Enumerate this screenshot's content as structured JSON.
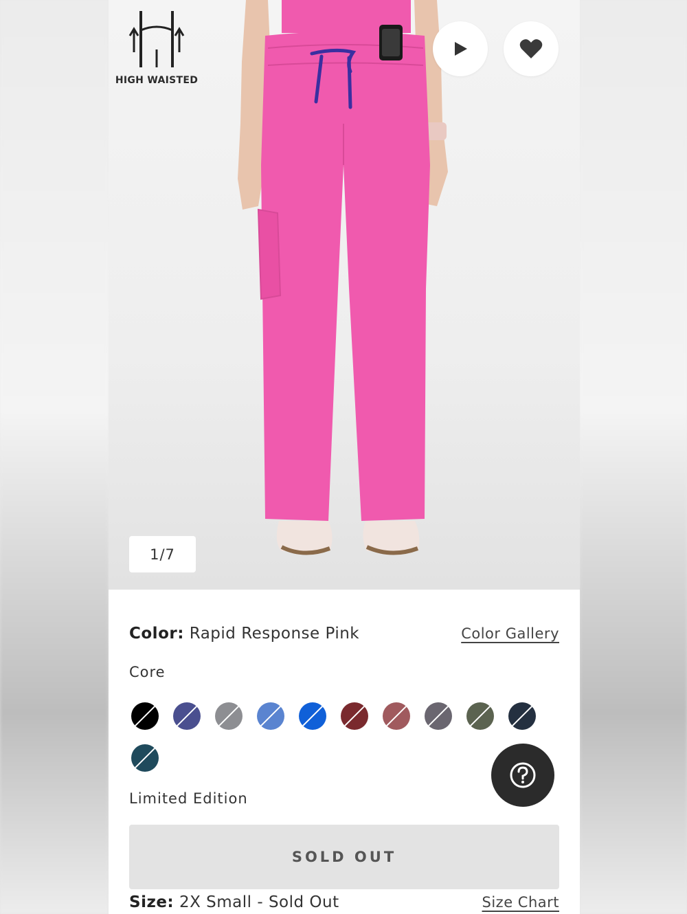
{
  "badge": {
    "label": "HIGH WAISTED",
    "icon": "high-waisted-icon"
  },
  "hero": {
    "product_color": "#f05aae",
    "drawstring_color": "#3a2fa0",
    "play_icon": "play-icon",
    "favorite_icon": "heart-icon",
    "image_counter": "1/7"
  },
  "color": {
    "label": "Color:",
    "value": "Rapid Response Pink",
    "gallery_link": "Color Gallery"
  },
  "core": {
    "label": "Core",
    "swatches": [
      "#000000",
      "#4a4f8f",
      "#8d8e92",
      "#5a84d0",
      "#1060d8",
      "#7a2a2e",
      "#a05a5e",
      "#6a6670",
      "#5b6350",
      "#243040",
      "#1f4a5c"
    ]
  },
  "limited": {
    "label": "Limited Edition"
  },
  "help": {
    "icon": "help-icon"
  },
  "cta": {
    "label": "SOLD OUT"
  },
  "size": {
    "label": "Size:",
    "value": "2X Small - Sold Out",
    "chart_link": "Size Chart"
  }
}
